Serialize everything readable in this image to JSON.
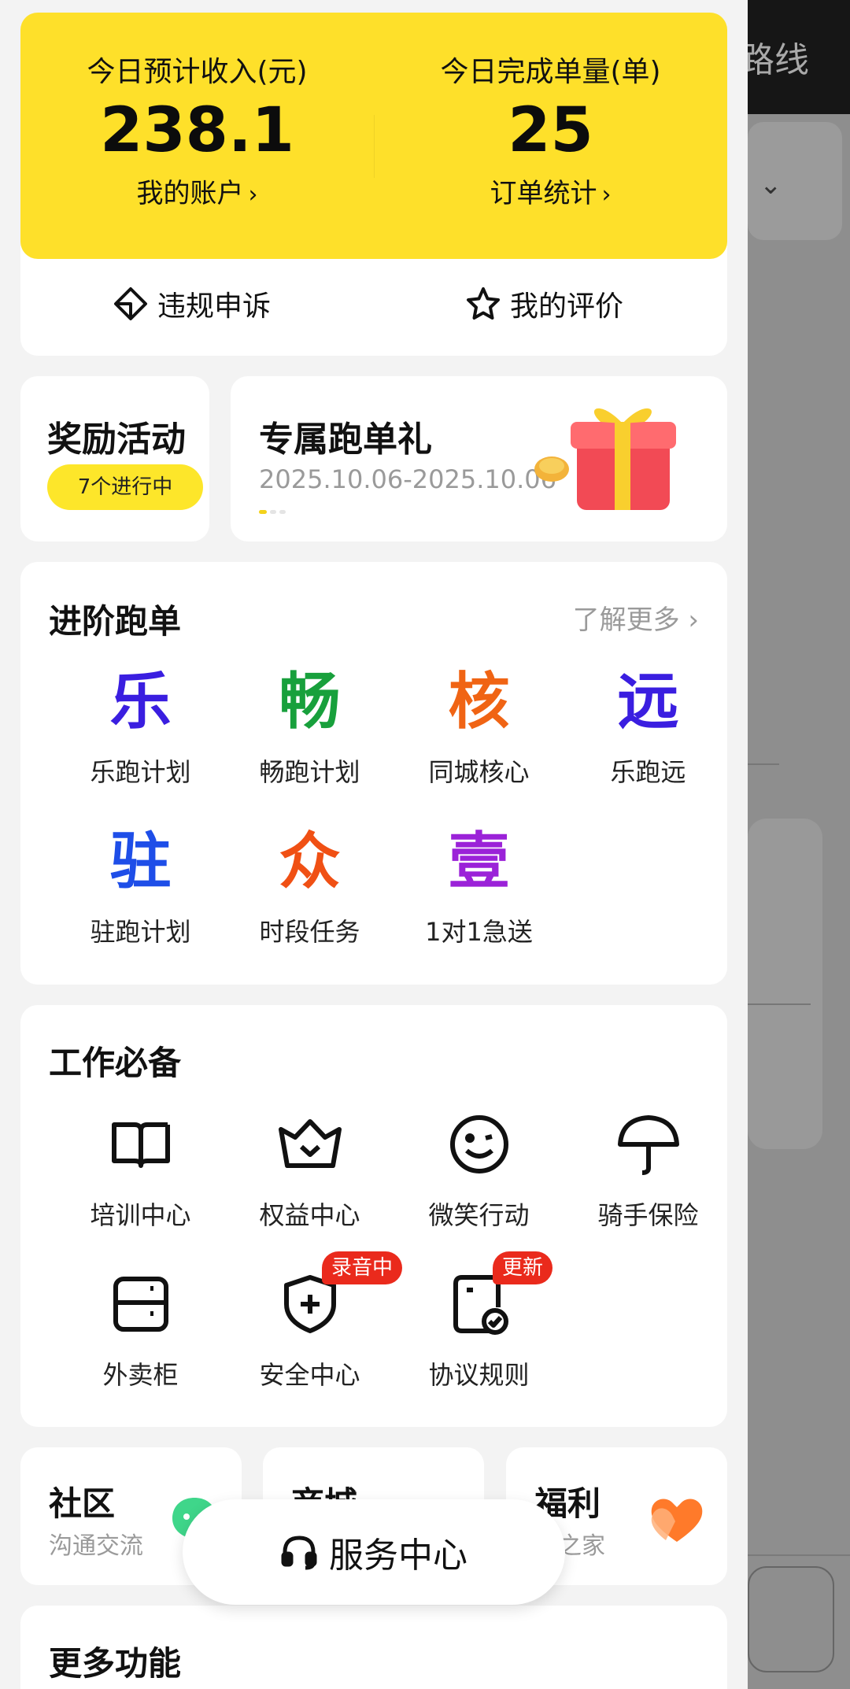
{
  "earnings": {
    "income_label": "今日预计收入(元)",
    "income_value": "238.1",
    "account_link": "我的账户",
    "orders_label": "今日完成单量(单)",
    "orders_value": "25",
    "stats_link": "订单统计",
    "arrow": "›"
  },
  "quick_actions": {
    "appeal": "违规申诉",
    "rating": "我的评价"
  },
  "reward": {
    "title": "奖励活动",
    "badge": "7个进行中"
  },
  "banner": {
    "title": "专属跑单礼",
    "date_range": "2025.10.06-2025.10.06"
  },
  "advanced": {
    "title": "进阶跑单",
    "more": "了解更多 ›",
    "items": [
      {
        "glyph": "乐",
        "label": "乐跑计划",
        "color": "#3a1ee0"
      },
      {
        "glyph": "畅",
        "label": "畅跑计划",
        "color": "#18a03c"
      },
      {
        "glyph": "核",
        "label": "同城核心",
        "color": "#f06414"
      },
      {
        "glyph": "远",
        "label": "乐跑远",
        "color": "#3a1ee0"
      },
      {
        "glyph": "驻",
        "label": "驻跑计划",
        "color": "#1e4ee8"
      },
      {
        "glyph": "众",
        "label": "时段任务",
        "color": "#f05014"
      },
      {
        "glyph": "壹",
        "label": "1对1急送",
        "color": "#9b22d8"
      }
    ]
  },
  "work": {
    "title": "工作必备",
    "items": [
      {
        "label": "培训中心",
        "icon": "book-icon"
      },
      {
        "label": "权益中心",
        "icon": "crown-icon"
      },
      {
        "label": "微笑行动",
        "icon": "smile-icon"
      },
      {
        "label": "骑手保险",
        "icon": "umbrella-icon"
      },
      {
        "label": "外卖柜",
        "icon": "locker-icon"
      },
      {
        "label": "安全中心",
        "icon": "shield-plus-icon",
        "tag": "录音中"
      },
      {
        "label": "协议规则",
        "icon": "document-check-icon",
        "tag": "更新"
      }
    ]
  },
  "mini_cards": [
    {
      "title": "社区",
      "subtitle": "沟通交流"
    },
    {
      "title": "商城",
      "subtitle": ""
    },
    {
      "title": "福利",
      "subtitle": "手之家"
    }
  ],
  "more_functions": {
    "title": "更多功能"
  },
  "service_center": {
    "label": "服务中心"
  },
  "background": {
    "header_text": "路线"
  },
  "colors": {
    "accent_yellow": "#fee02a",
    "tag_red": "#ea2a1c"
  }
}
